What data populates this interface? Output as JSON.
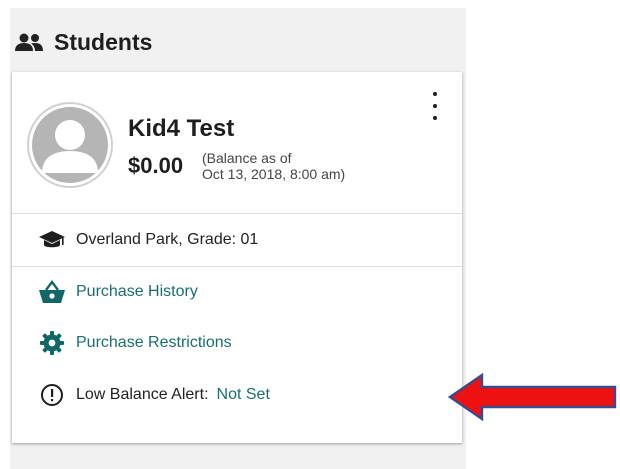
{
  "panel": {
    "title": "Students",
    "icon": "people-icon"
  },
  "student": {
    "name": "Kid4 Test",
    "balance": "$0.00",
    "balance_note_line1": "(Balance as of",
    "balance_note_line2": "Oct 13, 2018, 8:00 am)",
    "school_grade": "Overland Park, Grade: 01"
  },
  "actions": {
    "purchase_history": "Purchase History",
    "purchase_restrictions": "Purchase Restrictions",
    "low_balance_label": "Low Balance Alert:",
    "low_balance_value": "Not Set"
  },
  "icons": {
    "school": "graduation-cap-icon",
    "history": "shopping-basket-icon",
    "restrictions": "gear-icon",
    "alert": "alert-circle-icon",
    "menu": "more-vertical-icon"
  },
  "colors": {
    "panel_bg": "#f1f1f1",
    "card_bg": "#ffffff",
    "link": "#1a6e6e",
    "icon_teal": "#116666",
    "arrow_fill": "#ee1111",
    "arrow_outline": "#3a4a8a"
  }
}
